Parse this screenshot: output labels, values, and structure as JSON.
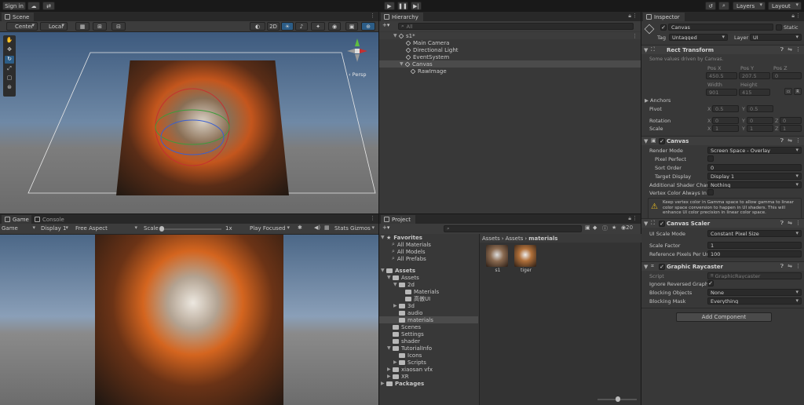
{
  "topbar": {
    "signin": "Sign in",
    "layers": "Layers",
    "layout": "Layout"
  },
  "scene": {
    "tab": "Scene",
    "center": "Center",
    "local": "Local",
    "mode2d": "2D",
    "persp": "‹ Persp"
  },
  "game": {
    "tab_game": "Game",
    "tab_console": "Console",
    "mode": "Game",
    "display": "Display 1",
    "aspect": "Free Aspect",
    "scale_label": "Scale",
    "scale_value": "1x",
    "play_focused": "Play Focused",
    "stats": "Stats",
    "gizmos": "Gizmos"
  },
  "hierarchy": {
    "tab": "Hierarchy",
    "search_placeholder": "All",
    "scene": "s1*",
    "items": [
      "Main Camera",
      "Directional Light",
      "EventSystem",
      "Canvas",
      "RawImage"
    ]
  },
  "project": {
    "tab": "Project",
    "favorites": "Favorites",
    "fav_items": [
      "All Materials",
      "All Models",
      "All Prefabs"
    ],
    "assets": "Assets",
    "tree": [
      "Assets",
      "2d",
      "Materials",
      "高傲UI",
      "3d",
      "audio",
      "materials",
      "Scenes",
      "Settings",
      "shader",
      "TutorialInfo",
      "Icons",
      "Scripts",
      "xiaosan vfx",
      "XR",
      "Packages"
    ],
    "breadcrumb": [
      "Assets",
      "Assets",
      "materials"
    ],
    "files": [
      "s1",
      "tiger"
    ],
    "count": "20"
  },
  "inspector": {
    "tab": "Inspector",
    "name": "Canvas",
    "static": "Static",
    "tag_label": "Tag",
    "tag": "Untagged",
    "layer_label": "Layer",
    "layer": "UI",
    "rect": {
      "title": "Rect Transform",
      "note": "Some values driven by Canvas.",
      "posx_l": "Pos X",
      "posy_l": "Pos Y",
      "posz_l": "Pos Z",
      "posx": "450.5",
      "posy": "207.5",
      "posz": "0",
      "width_l": "Width",
      "height_l": "Height",
      "width": "901",
      "height": "415",
      "anchors": "Anchors",
      "pivot": "Pivot",
      "pivot_x": "0.5",
      "pivot_y": "0.5",
      "rotation": "Rotation",
      "rot_x": "0",
      "rot_y": "0",
      "rot_z": "0",
      "scale": "Scale",
      "sc_x": "1",
      "sc_y": "1",
      "sc_z": "1",
      "x": "X",
      "y": "Y",
      "z": "Z"
    },
    "canvas": {
      "title": "Canvas",
      "render_mode_l": "Render Mode",
      "render_mode": "Screen Space - Overlay",
      "pixel_perfect_l": "Pixel Perfect",
      "sort_order_l": "Sort Order",
      "sort_order": "0",
      "target_display_l": "Target Display",
      "target_display": "Display 1",
      "shader_ch_l": "Additional Shader Chann",
      "shader_ch": "Nothing",
      "vertex_color_l": "Vertex Color Always In G",
      "warning": "Keep vertex color in Gamma space to allow gamma to linear color space conversion to happen in UI shaders. This will enhance UI color precision in linear color space."
    },
    "scaler": {
      "title": "Canvas Scaler",
      "scale_mode_l": "UI Scale Mode",
      "scale_mode": "Constant Pixel Size",
      "scale_factor_l": "Scale Factor",
      "scale_factor": "1",
      "ref_ppu_l": "Reference Pixels Per Unit",
      "ref_ppu": "100"
    },
    "raycaster": {
      "title": "Graphic Raycaster",
      "script_l": "Script",
      "script": "GraphicRaycaster",
      "ignore_l": "Ignore Reversed Graphic",
      "blocking_obj_l": "Blocking Objects",
      "blocking_obj": "None",
      "blocking_mask_l": "Blocking Mask",
      "blocking_mask": "Everything"
    },
    "add_component": "Add Component"
  },
  "colors": {
    "accent": "#2c5d87",
    "selection": "#2c5d87",
    "panel": "#383838"
  }
}
